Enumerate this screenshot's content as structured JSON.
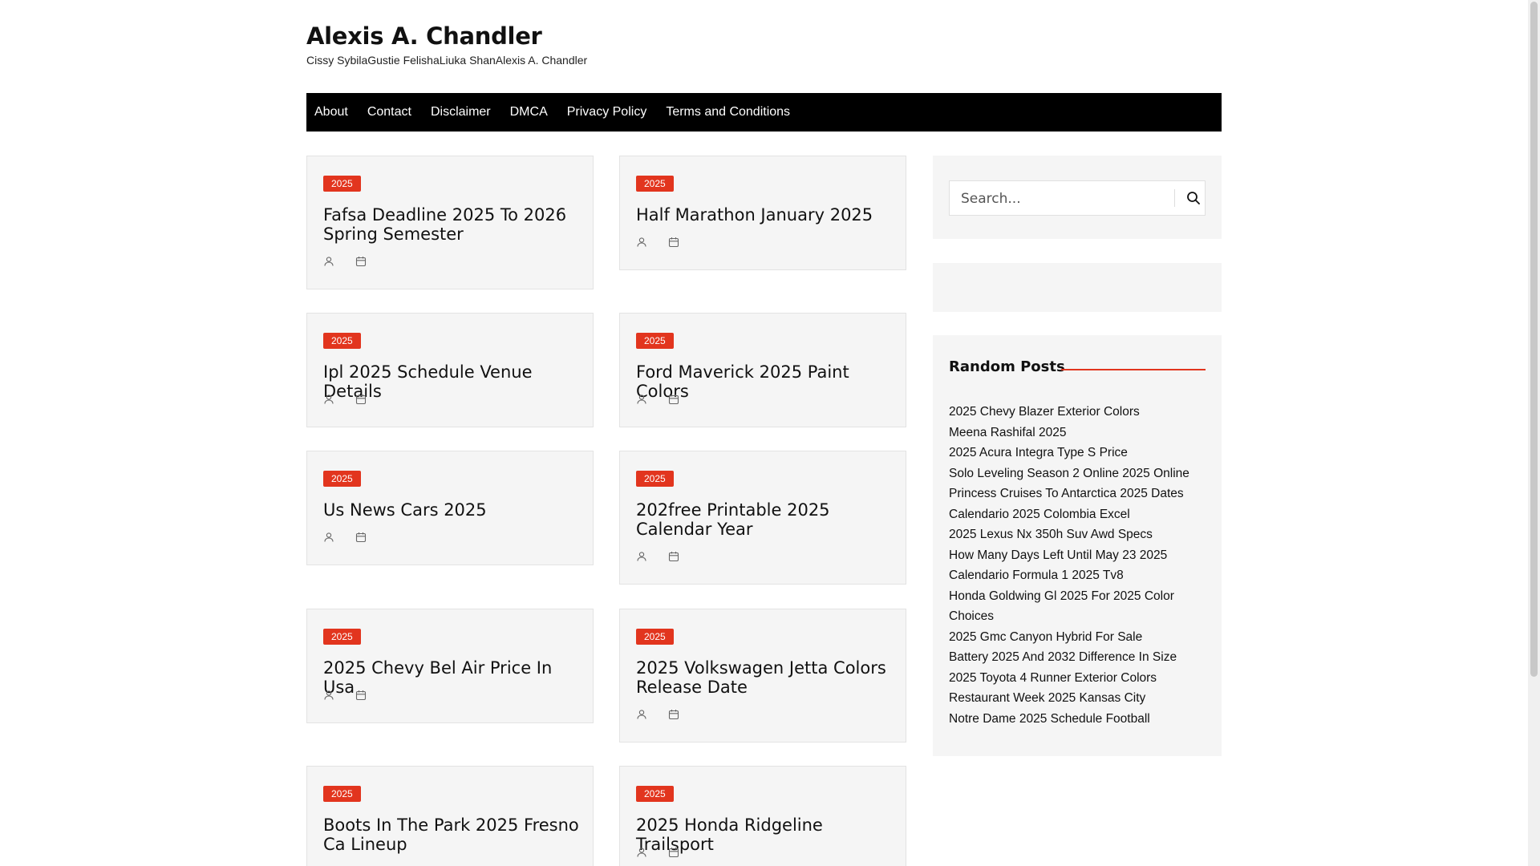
{
  "site": {
    "title": "Alexis A. Chandler",
    "description": "Cissy SybilaGustie FelishaLiuka ShanAlexis A. Chandler"
  },
  "nav": {
    "items": [
      "About",
      "Contact",
      "Disclaimer",
      "DMCA",
      "Privacy Policy",
      "Terms and Conditions"
    ]
  },
  "posts": [
    {
      "category": "2025",
      "title": "Fafsa Deadline 2025 To 2026 Spring Semester"
    },
    {
      "category": "2025",
      "title": "Half Marathon January 2025"
    },
    {
      "category": "2025",
      "title": "Ipl 2025 Schedule Venue Details"
    },
    {
      "category": "2025",
      "title": "Ford Maverick 2025 Paint Colors"
    },
    {
      "category": "2025",
      "title": "Us News Cars 2025"
    },
    {
      "category": "2025",
      "title": "202free Printable 2025 Calendar Year"
    },
    {
      "category": "2025",
      "title": "2025 Chevy Bel Air Price In Usa"
    },
    {
      "category": "2025",
      "title": "2025 Volkswagen Jetta Colors Release Date"
    },
    {
      "category": "2025",
      "title": "Boots In The Park 2025 Fresno Ca Lineup"
    },
    {
      "category": "2025",
      "title": "2025 Honda Ridgeline Trailsport"
    }
  ],
  "search": {
    "placeholder": "Search..."
  },
  "random_posts": {
    "heading": "Random Posts",
    "items": [
      "2025 Chevy Blazer Exterior Colors",
      "Meena Rashifal 2025",
      "2025 Acura Integra Type S Price",
      "Solo Leveling Season 2 Online 2025 Online",
      "Princess Cruises To Antarctica 2025 Dates",
      "Calendario 2025 Colombia Excel",
      "2025 Lexus Nx 350h Suv Awd Specs",
      "How Many Days Left Until May 23 2025",
      "Calendario Formula 1 2025 Tv8",
      "Honda Goldwing Gl 2025 For 2025 Color Choices",
      "2025 Gmc Canyon Hybrid For Sale",
      "Battery 2025 And 2032 Difference In Size",
      "2025 Toyota 4 Runner Exterior Colors",
      "Restaurant Week 2025 Kansas City",
      "Notre Dame 2025 Schedule Football"
    ]
  },
  "colors": {
    "accent": "#e2351e",
    "nav_bg": "#000000",
    "card_bg": "#f5f5f5"
  },
  "icons": {
    "author": "user-icon",
    "date": "calendar-icon",
    "search": "search-icon"
  }
}
